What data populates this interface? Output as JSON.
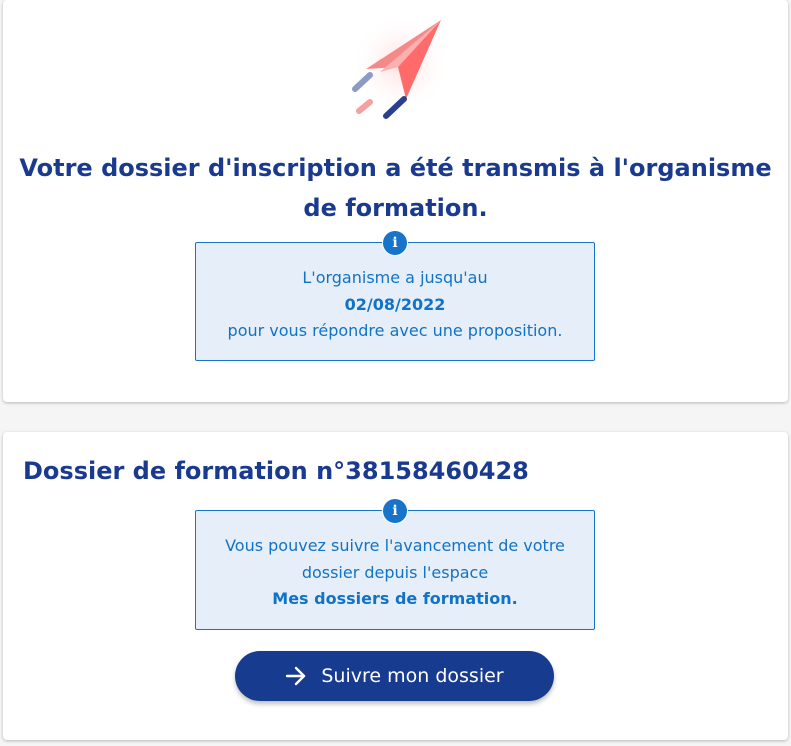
{
  "confirmation": {
    "title": "Votre dossier d'inscription a été transmis à l'organisme de formation.",
    "info": {
      "icon": "info-icon",
      "line1": "L'organisme a jusqu'au",
      "deadline": "02/08/2022",
      "line3": "pour vous répondre avec une proposition."
    },
    "illustration_icon": "paper-plane-icon"
  },
  "dossier": {
    "title": "Dossier de formation n°38158460428",
    "info": {
      "icon": "info-icon",
      "line1": "Vous pouvez suivre l'avancement de votre",
      "line2": "dossier depuis l'espace",
      "link_text": "Mes dossiers de formation."
    },
    "button": {
      "label": "Suivre mon dossier",
      "icon": "arrow-right-icon"
    }
  },
  "colors": {
    "primary": "#1a3a8f",
    "info_text": "#1272c5",
    "info_bg": "#e6eff9",
    "button_bg": "#173b8f"
  }
}
